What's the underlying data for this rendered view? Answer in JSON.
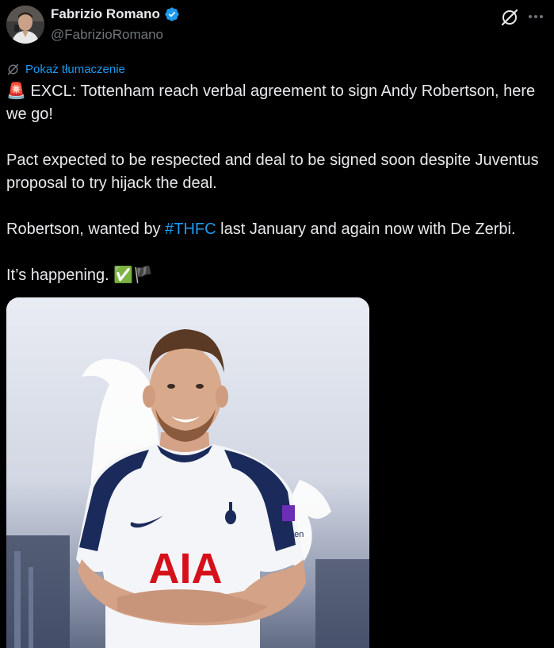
{
  "author": {
    "display_name": "Fabrizio Romano",
    "handle": "@FabrizioRomano",
    "verified": true
  },
  "actions": {
    "grok_icon": "grok-icon",
    "more_icon": "more-options-icon"
  },
  "translate": {
    "label": "Pokaż tłumaczenie"
  },
  "tweet": {
    "emoji_siren": "🚨",
    "line1": "EXCL: Tottenham reach verbal agreement to sign Andy Robertson, here we go!",
    "para2": "Pact expected to be respected and deal to be signed soon despite Juventus proposal to try hijack the deal.",
    "para3_before": "Robertson, wanted by ",
    "para3_hashtag": "#THFC",
    "para3_after": " last January and again now with De Zerbi.",
    "para4_text": "It’s happening. ",
    "emoji_check": "✅",
    "emoji_flag": "🏴"
  },
  "media": {
    "shirt_sponsor": "AIA",
    "sleeve_sponsor": "Kraken"
  },
  "colors": {
    "background": "#000000",
    "text": "#e7e9ea",
    "secondary": "#71767b",
    "link": "#1d9bf0"
  }
}
